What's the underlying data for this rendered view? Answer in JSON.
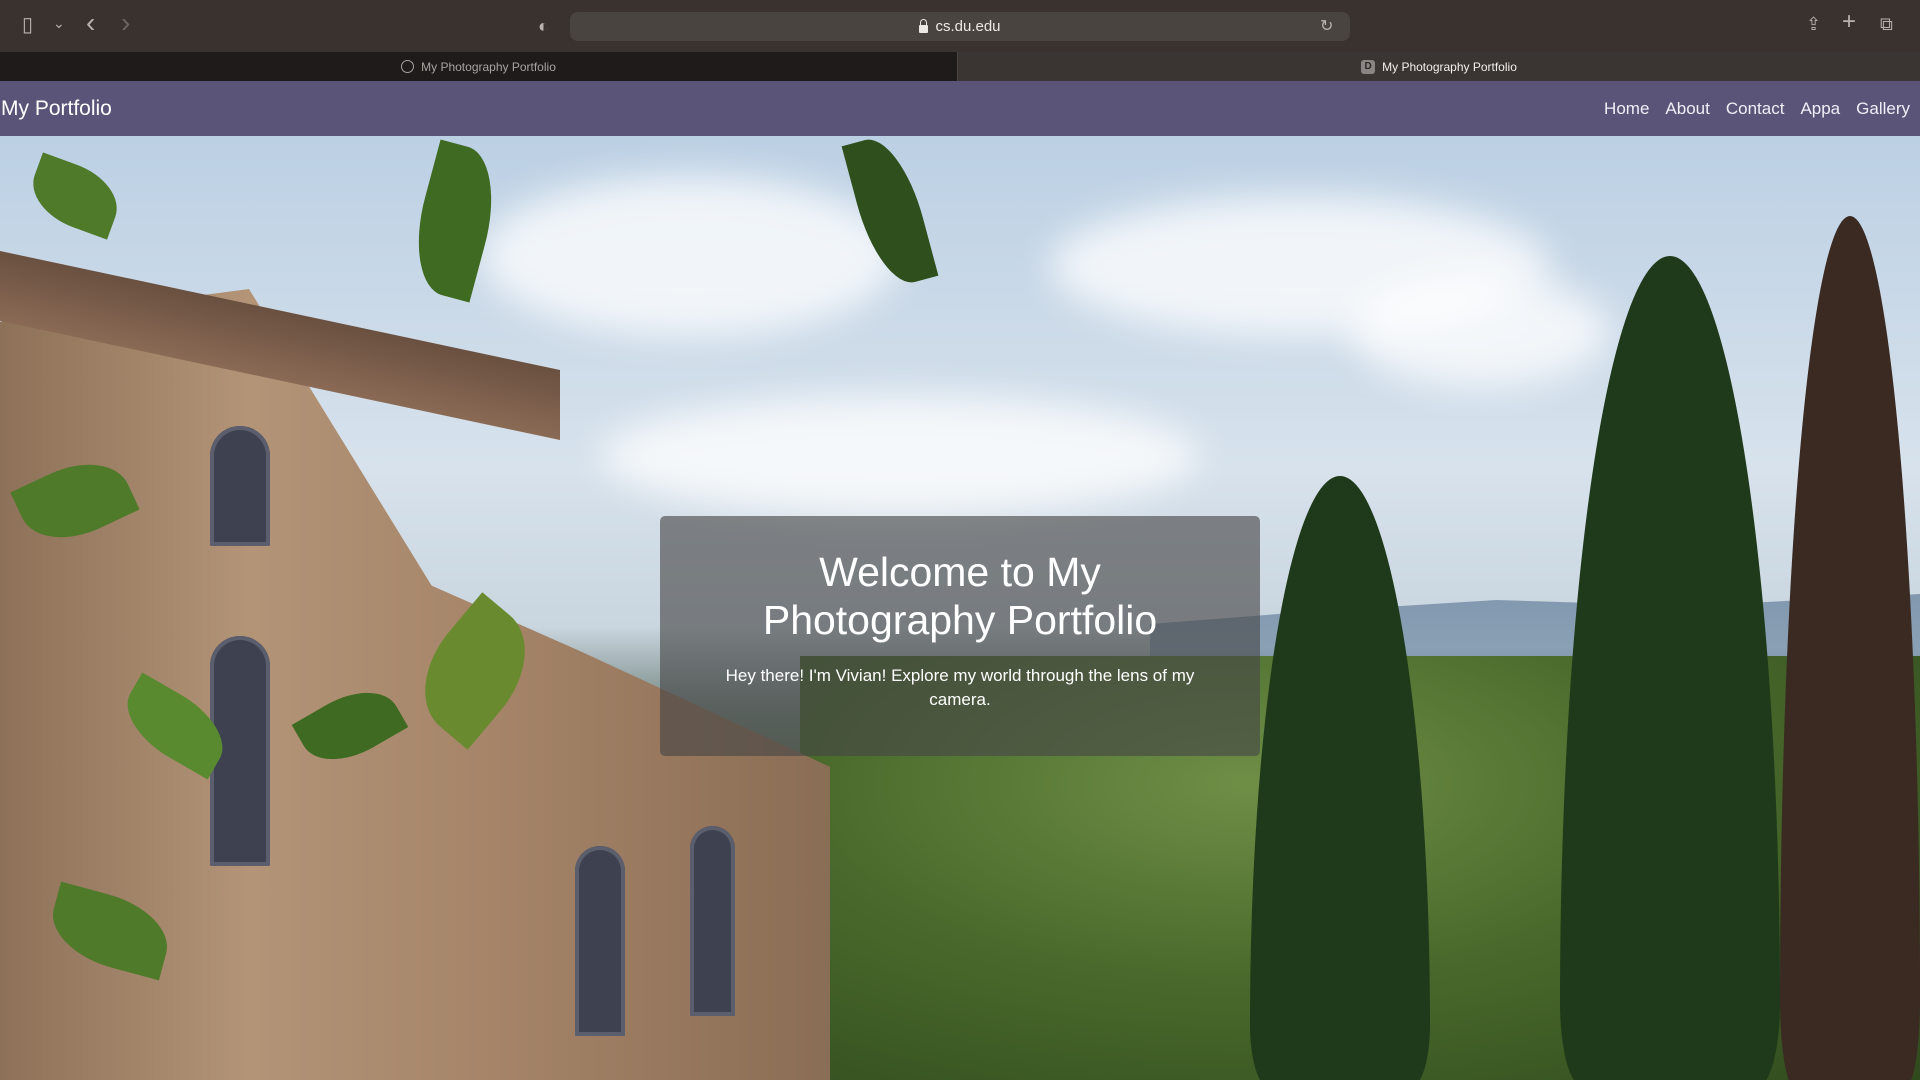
{
  "browser": {
    "url": "cs.du.edu",
    "tabs": [
      {
        "title": "My Photography Portfolio",
        "active": false,
        "favicon": "compass-icon"
      },
      {
        "title": "My Photography Portfolio",
        "active": true,
        "favicon": "D"
      }
    ],
    "icons": {
      "sidebar": "▯",
      "chevron": "⌄",
      "back": "‹",
      "forward": "›",
      "extension": "◐",
      "reload": "↻",
      "share": "⇪",
      "new_tab": "+",
      "tabs_overview": "⧉"
    }
  },
  "navbar": {
    "brand": "My Portfolio",
    "links": [
      "Home",
      "About",
      "Contact",
      "Appa",
      "Gallery"
    ],
    "background": "#5a5478"
  },
  "hero": {
    "title": "Welcome to My Photography Portfolio",
    "subtitle": "Hey there! I'm Vivian! Explore my world through the lens of my camera."
  }
}
